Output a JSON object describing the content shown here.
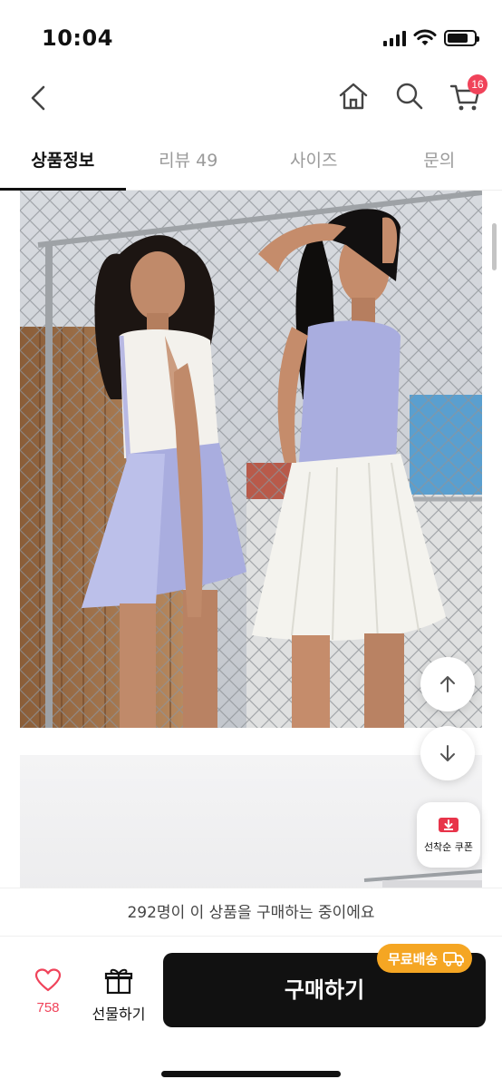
{
  "status_bar": {
    "time": "10:04"
  },
  "nav": {
    "back_icon": "chevron-left-icon",
    "home_icon": "home-icon",
    "search_icon": "search-icon",
    "cart_icon": "cart-icon",
    "cart_count": "16"
  },
  "tabs": [
    {
      "label": "상품정보",
      "active": true
    },
    {
      "label": "리뷰 49",
      "active": false
    },
    {
      "label": "사이즈",
      "active": false
    },
    {
      "label": "문의",
      "active": false
    }
  ],
  "floating": {
    "scroll_up_icon": "arrow-up-icon",
    "scroll_down_icon": "arrow-down-icon",
    "coupon_label": "선착순 쿠폰"
  },
  "notice": {
    "text": "292명이 이 상품을 구매하는 중이에요"
  },
  "bottom_bar": {
    "like_count": "758",
    "gift_label": "선물하기",
    "buy_label": "구매하기",
    "free_shipping_label": "무료배송"
  },
  "colors": {
    "accent": "#f0435a",
    "buy_button": "#111111",
    "free_shipping": "#f5a623",
    "skirt_lavender": "#a9addf",
    "skirt_white": "#f4f3ee"
  }
}
